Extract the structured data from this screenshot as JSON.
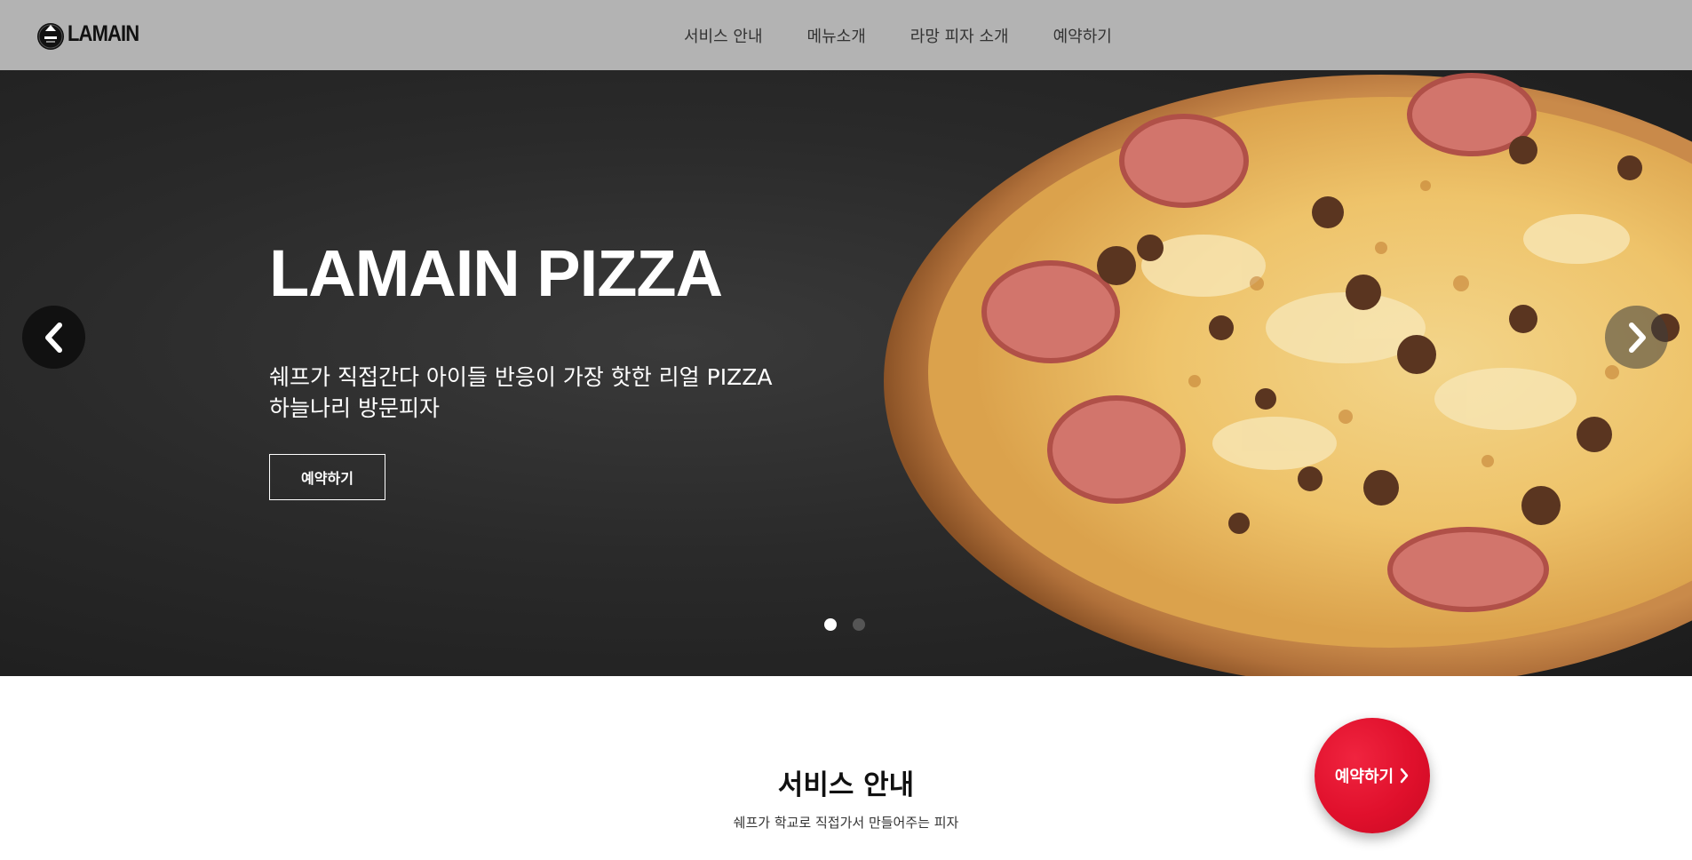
{
  "header": {
    "logo_text": "LAMAIN",
    "logo_badge_text": "LAMAIN",
    "nav": [
      {
        "label": "서비스 안내"
      },
      {
        "label": "메뉴소개"
      },
      {
        "label": "라망 피자 소개"
      },
      {
        "label": "예약하기"
      }
    ]
  },
  "hero": {
    "title": "LAMAIN PIZZA",
    "subtitle_line1": "쉐프가 직접간다 아이들 반응이 가장 핫한 리얼 PIZZA",
    "subtitle_line2": "하늘나리 방문피자",
    "button_label": "예약하기",
    "slide_count": 2,
    "active_slide": 1,
    "prev_icon": "chevron-left-icon",
    "next_icon": "chevron-right-icon"
  },
  "service": {
    "title": "서비스 안내",
    "description": "쉐프가 학교로 직접가서 만들어주는 피자"
  },
  "floating_button": {
    "label": "예약하기",
    "icon": "chevron-right-icon",
    "color": "#e0102c"
  },
  "colors": {
    "header_bg": "#b3b3b3",
    "hero_bg": "#2a2a2a",
    "accent": "#e0102c"
  }
}
